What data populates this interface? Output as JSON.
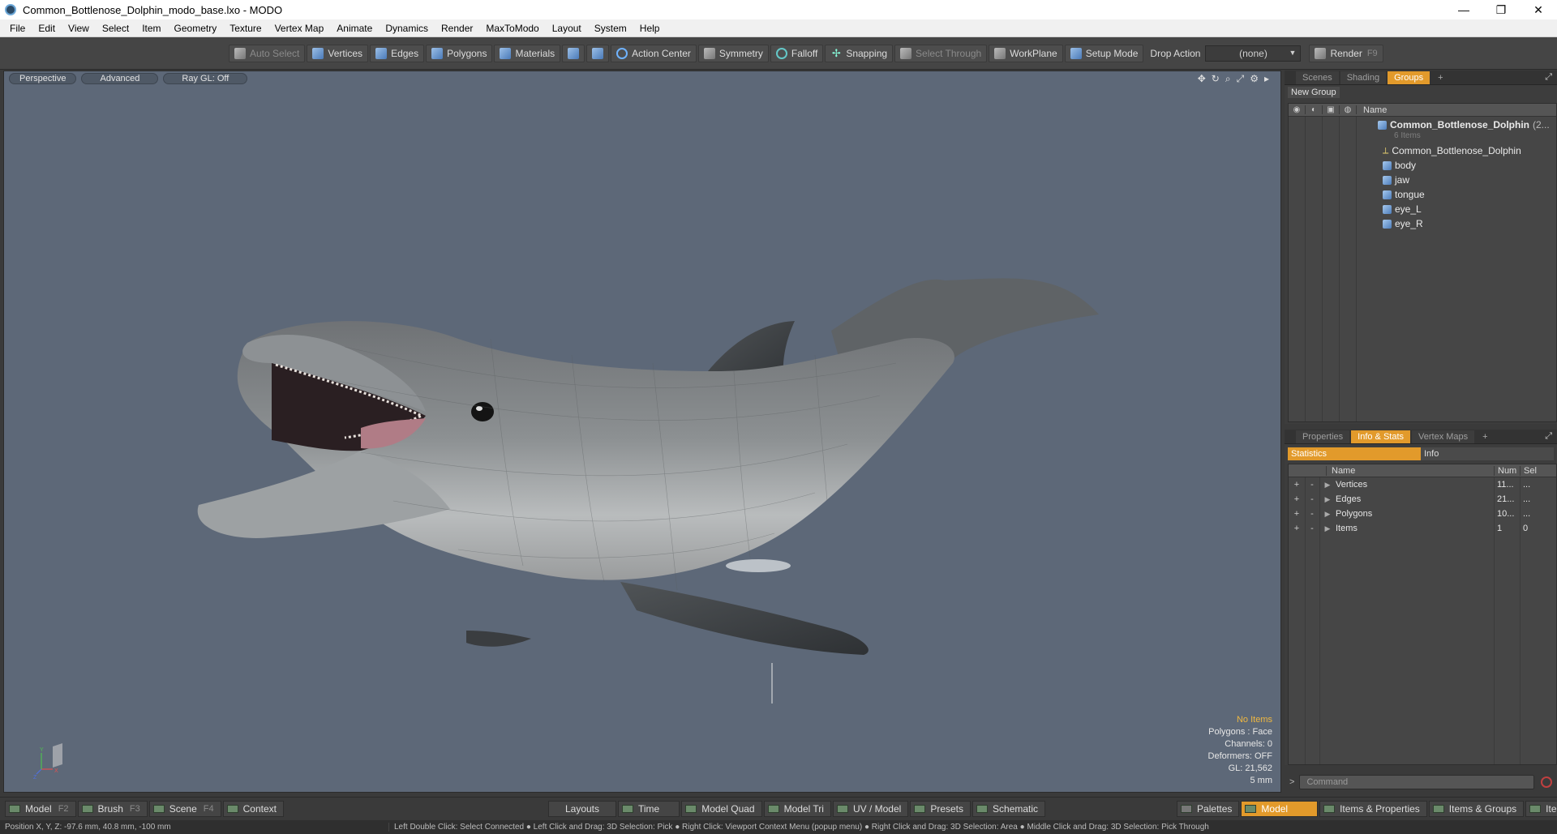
{
  "window": {
    "title": "Common_Bottlenose_Dolphin_modo_base.lxo - MODO",
    "minimize": "—",
    "maximize": "❐",
    "close": "✕"
  },
  "menu": [
    "File",
    "Edit",
    "View",
    "Select",
    "Item",
    "Geometry",
    "Texture",
    "Vertex Map",
    "Animate",
    "Dynamics",
    "Render",
    "MaxToModo",
    "Layout",
    "System",
    "Help"
  ],
  "toolbar": {
    "auto_select": "Auto Select",
    "vertices": "Vertices",
    "edges": "Edges",
    "polygons": "Polygons",
    "materials": "Materials",
    "action_center": "Action Center",
    "symmetry": "Symmetry",
    "falloff": "Falloff",
    "snapping": "Snapping",
    "select_through": "Select Through",
    "workplane": "WorkPlane",
    "setup_mode": "Setup Mode",
    "drop_action_label": "Drop Action",
    "drop_action_value": "(none)",
    "render": "Render",
    "render_key": "F9"
  },
  "viewport": {
    "view_mode": "Perspective",
    "shading": "Advanced",
    "raygl": "Ray GL: Off",
    "overlay": {
      "selection": "No Items",
      "polygons": "Polygons : Face",
      "channels": "Channels: 0",
      "deformers": "Deformers: OFF",
      "gl": "GL: 21,562",
      "scale": "5 mm"
    },
    "axis_x": "X",
    "axis_y": "Y",
    "axis_z": "Z"
  },
  "groups_panel": {
    "tabs": [
      "Scenes",
      "Shading",
      "Groups"
    ],
    "active_tab": "Groups",
    "new_group": "New Group",
    "col_name": "Name",
    "root": "Common_Bottlenose_Dolphin",
    "root_suffix": "(2...",
    "root_count": "6 Items",
    "items": [
      "Common_Bottlenose_Dolphin",
      "body",
      "jaw",
      "tongue",
      "eye_L",
      "eye_R"
    ]
  },
  "info_panel": {
    "tabs": [
      "Properties",
      "Info & Stats",
      "Vertex Maps"
    ],
    "active_tab": "Info & Stats",
    "subtabs": [
      "Statistics",
      "Info"
    ],
    "col_name": "Name",
    "col_num": "Num",
    "col_sel": "Sel",
    "rows": [
      {
        "name": "Vertices",
        "num": "11...",
        "sel": "..."
      },
      {
        "name": "Edges",
        "num": "21...",
        "sel": "..."
      },
      {
        "name": "Polygons",
        "num": "10...",
        "sel": "..."
      },
      {
        "name": "Items",
        "num": "1",
        "sel": "0"
      }
    ]
  },
  "command": {
    "placeholder": "Command"
  },
  "bottombar": {
    "model": "Model",
    "model_key": "F2",
    "brush": "Brush",
    "brush_key": "F3",
    "scene": "Scene",
    "scene_key": "F4",
    "context": "Context",
    "layouts": "Layouts",
    "time": "Time",
    "model_quad": "Model Quad",
    "model_tri": "Model Tri",
    "uv_model": "UV / Model",
    "presets": "Presets",
    "schematic": "Schematic",
    "palettes": "Palettes",
    "model_active": "Model",
    "items_properties": "Items & Properties",
    "items_groups": "Items & Groups",
    "items_shading": "Items & Shading"
  },
  "status": {
    "position": "Position X, Y, Z:  -97.6 mm, 40.8 mm, -100 mm",
    "hint": "Left Double Click: Select Connected ● Left Click and Drag: 3D Selection: Pick ● Right Click: Viewport Context Menu (popup menu) ● Right Click and Drag: 3D Selection: Area ● Middle Click and Drag: 3D Selection: Pick Through"
  },
  "colors": {
    "accent": "#e29a2b",
    "viewport_bg": "#5d6878",
    "overlay_highlight": "#f0b840"
  }
}
